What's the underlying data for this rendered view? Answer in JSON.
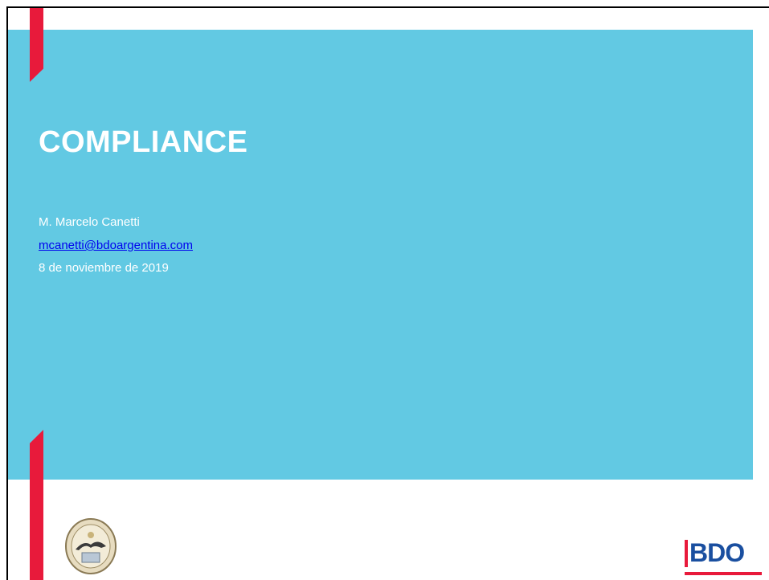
{
  "slide": {
    "title": "COMPLIANCE",
    "presenter_name": "M. Marcelo Canetti",
    "presenter_email": "mcanetti@bdoargentina.com",
    "date": "8 de noviembre de 2019"
  },
  "logos": {
    "left_icon": "institution-seal-icon",
    "right_text": "BDO"
  },
  "colors": {
    "panel": "#62c9e3",
    "accent_red": "#e81a3b",
    "bdo_blue": "#1a4fa0",
    "link": "#0000ee"
  }
}
